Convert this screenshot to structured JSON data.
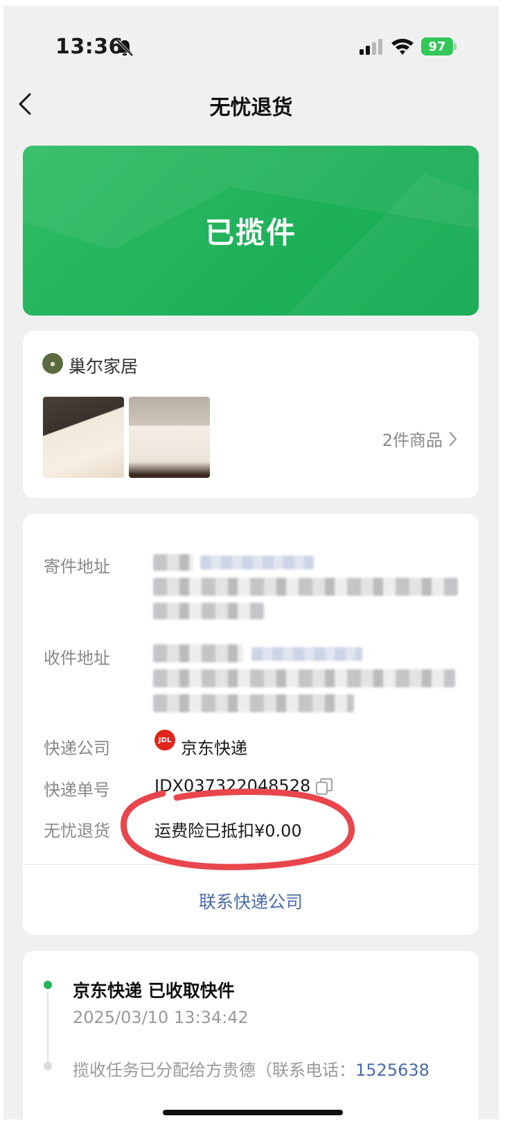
{
  "status_bar": {
    "time": "13:36",
    "battery": "97"
  },
  "nav": {
    "title": "无忧退货"
  },
  "banner": {
    "status": "已揽件"
  },
  "store": {
    "name": "巢尔家居",
    "items_count": "2件商品"
  },
  "details": {
    "sender_label": "寄件地址",
    "receiver_label": "收件地址",
    "courier_label": "快递公司",
    "courier_name": "京东快递",
    "tracking_label": "快递单号",
    "tracking_number": "JDX037322048528",
    "worry_free_label": "无忧退货",
    "worry_free_value": "运费险已抵扣¥0.00",
    "contact_button": "联系快递公司"
  },
  "tracking": {
    "latest_title": "京东快递 已收取快件",
    "latest_time": "2025/03/10 13:34:42",
    "prev_desc": "揽收任务已分配给方贵德（联系电话：",
    "prev_phone": "1525638"
  },
  "colors": {
    "accent_green": "#22b35c",
    "link_blue": "#4a6ba8",
    "annotation_red": "#e8464c",
    "jd_red": "#e1251b"
  },
  "icons": [
    "bell-slash-icon",
    "signal-icon",
    "wifi-icon",
    "battery-icon",
    "back-icon",
    "chevron-right-icon",
    "copy-icon"
  ]
}
